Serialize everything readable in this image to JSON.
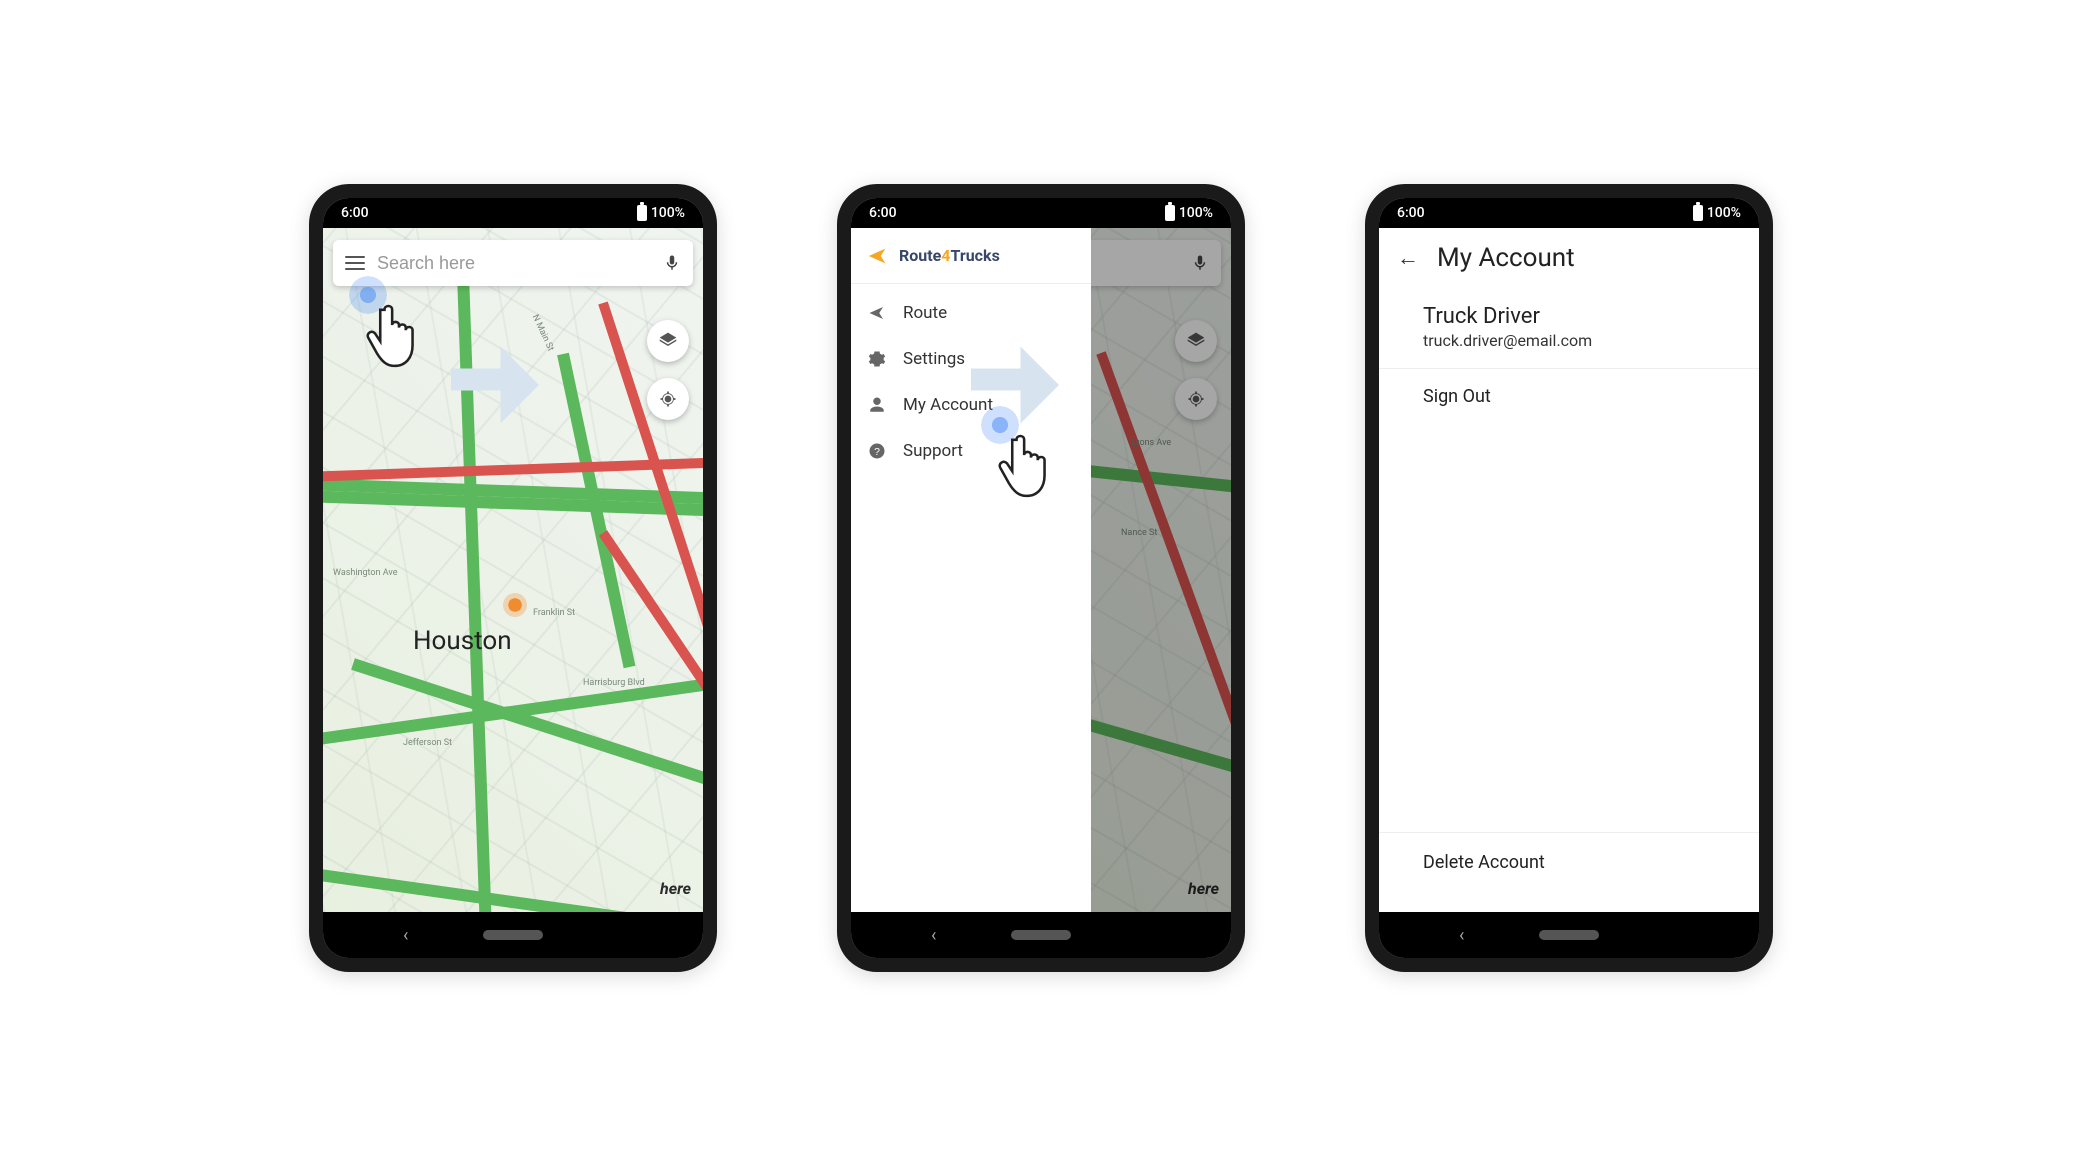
{
  "status": {
    "time": "6:00",
    "battery": "100%"
  },
  "phone1": {
    "search_placeholder": "Search here",
    "city": "Houston",
    "map_attribution": "here"
  },
  "brand": {
    "prefix": "Route",
    "num": "4",
    "suffix": "Trucks"
  },
  "drawer": {
    "items": [
      {
        "label": "Route",
        "icon": "navigation-icon"
      },
      {
        "label": "Settings",
        "icon": "gear-icon"
      },
      {
        "label": "My Account",
        "icon": "person-icon"
      },
      {
        "label": "Support",
        "icon": "help-icon"
      }
    ]
  },
  "account": {
    "title": "My Account",
    "name": "Truck Driver",
    "email": "truck.driver@email.com",
    "signout": "Sign Out",
    "delete": "Delete Account"
  }
}
